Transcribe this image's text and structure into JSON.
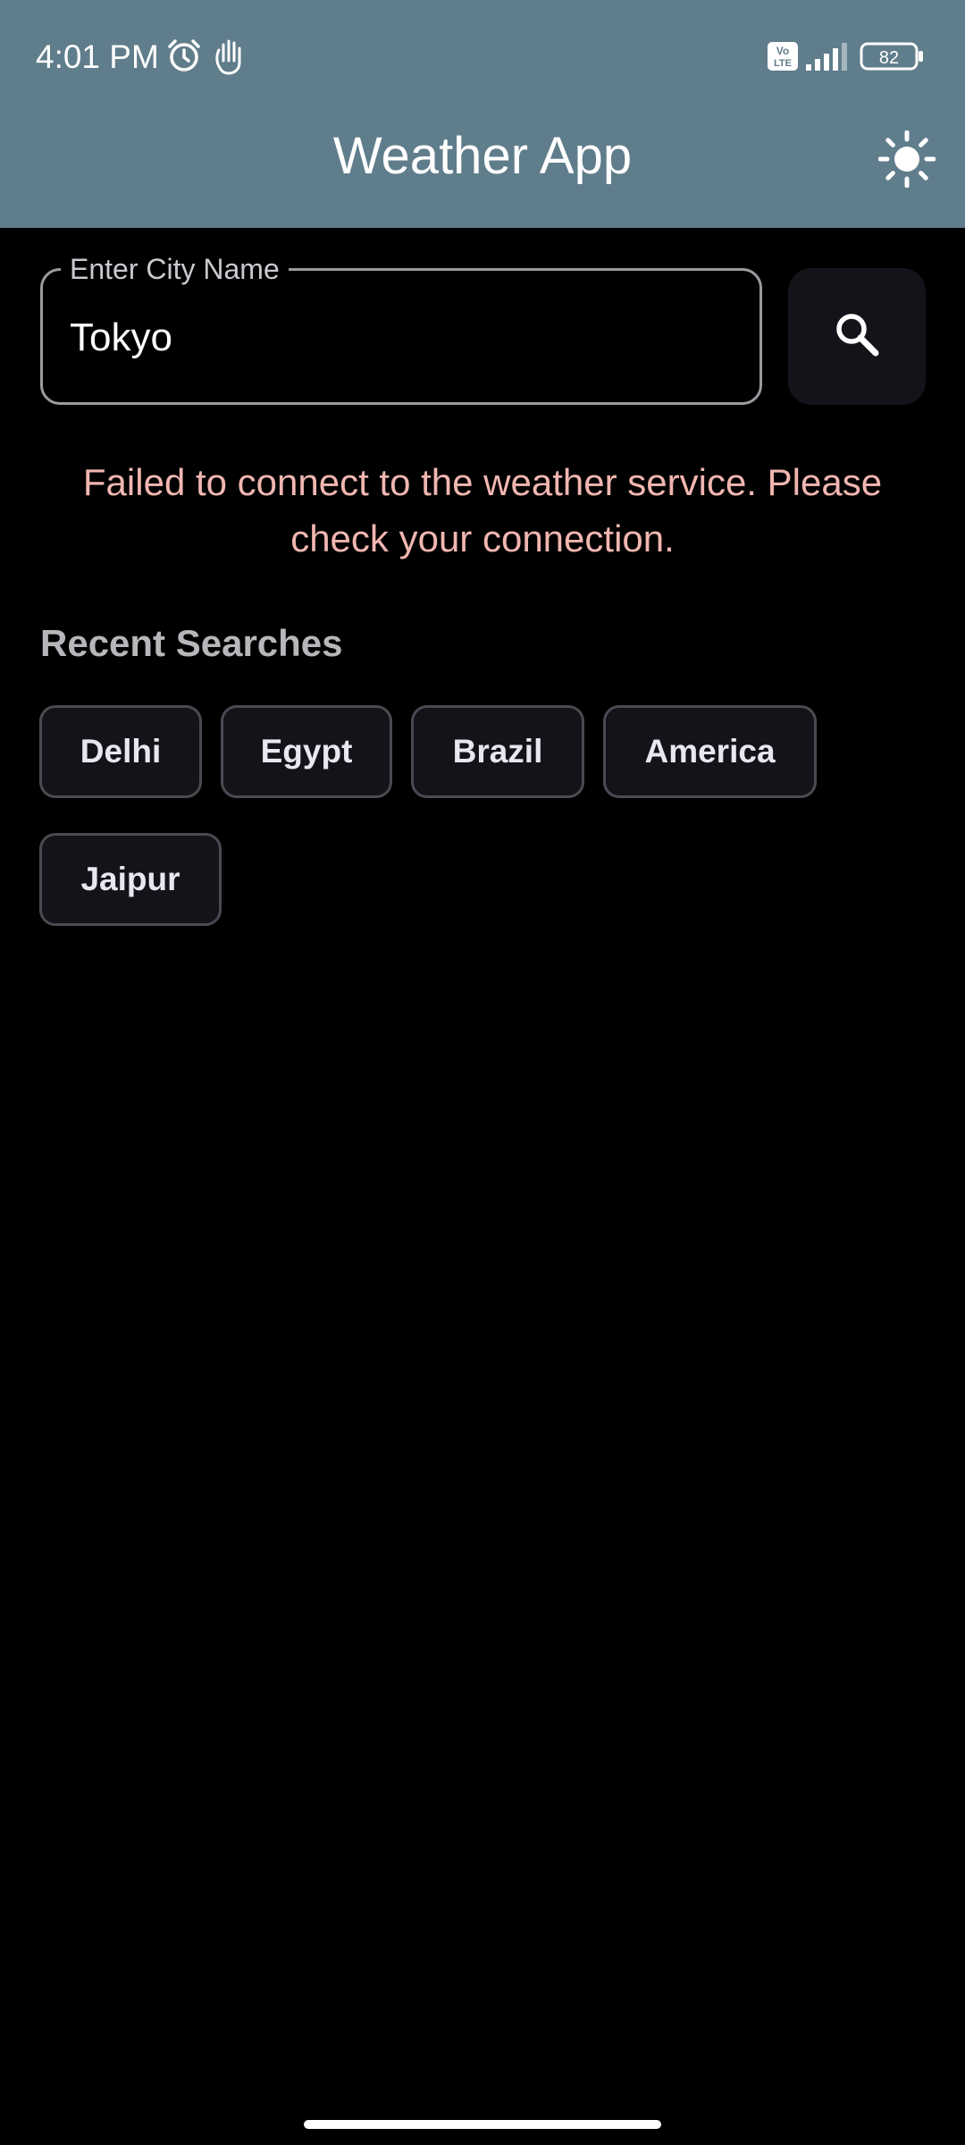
{
  "status_bar": {
    "time": "4:01 PM",
    "icons": [
      "alarm-icon",
      "gesture-icon",
      "volte-icon",
      "signal-icon",
      "battery-icon"
    ],
    "battery_level": "82"
  },
  "app_bar": {
    "title": "Weather App",
    "theme_toggle_icon": "sun-icon"
  },
  "search": {
    "label": "Enter City Name",
    "value": "Tokyo",
    "button_icon": "search-icon"
  },
  "error_message": "Failed to connect to the weather service. Please check your connection.",
  "recent_searches": {
    "title": "Recent Searches",
    "items": [
      "Delhi",
      "Egypt",
      "Brazil",
      "America",
      "Jaipur"
    ]
  },
  "colors": {
    "app_bar": "#607D8B",
    "background": "#000000",
    "error_text": "#F1B6B0",
    "chip_background": "#141319",
    "chip_border": "#4B4A52"
  }
}
